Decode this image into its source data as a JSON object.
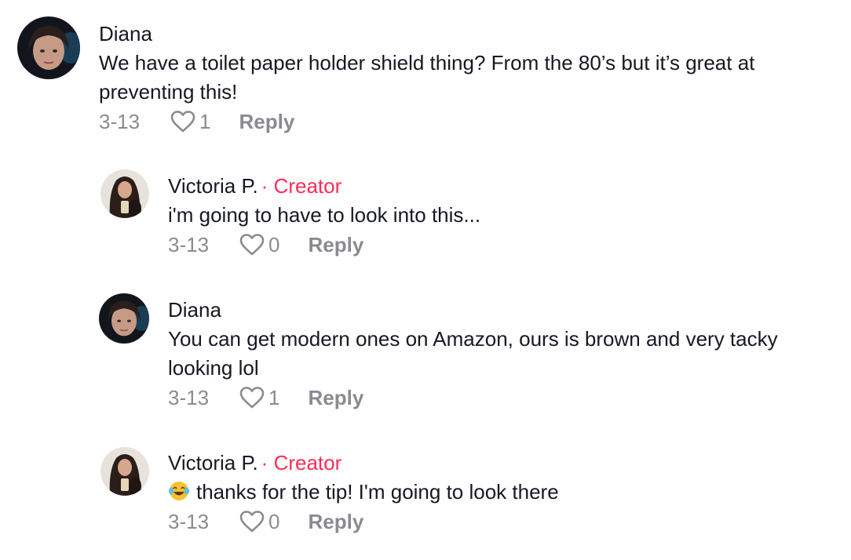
{
  "colors": {
    "creator_accent": "#fe2c55",
    "meta_gray": "#8a8b91",
    "text": "#161823"
  },
  "comments": [
    {
      "author": "Diana",
      "creator_label": "",
      "text": "We have a toilet paper holder shield thing? From the 80’s but it’s great at preventing this!",
      "date": "3-13",
      "likes": "1",
      "reply_label": "Reply",
      "avatar_icon": "woman-portrait-dark-avatar"
    },
    {
      "author": "Victoria P.",
      "creator_dot": "·",
      "creator_label": "Creator",
      "text": "i'm going to have to look into this...",
      "date": "3-13",
      "likes": "0",
      "reply_label": "Reply",
      "avatar_icon": "woman-long-hair-avatar"
    },
    {
      "author": "Diana",
      "creator_label": "",
      "text": "You can get modern ones on Amazon, ours is brown and very tacky looking lol",
      "date": "3-13",
      "likes": "1",
      "reply_label": "Reply",
      "avatar_icon": "woman-portrait-dark-avatar"
    },
    {
      "author": "Victoria P.",
      "creator_dot": "·",
      "creator_label": "Creator",
      "emoji_icon": "face-with-tears-of-joy-emoji",
      "text": "thanks for the tip! I'm going to look there",
      "date": "3-13",
      "likes": "0",
      "reply_label": "Reply",
      "avatar_icon": "woman-long-hair-avatar"
    }
  ]
}
